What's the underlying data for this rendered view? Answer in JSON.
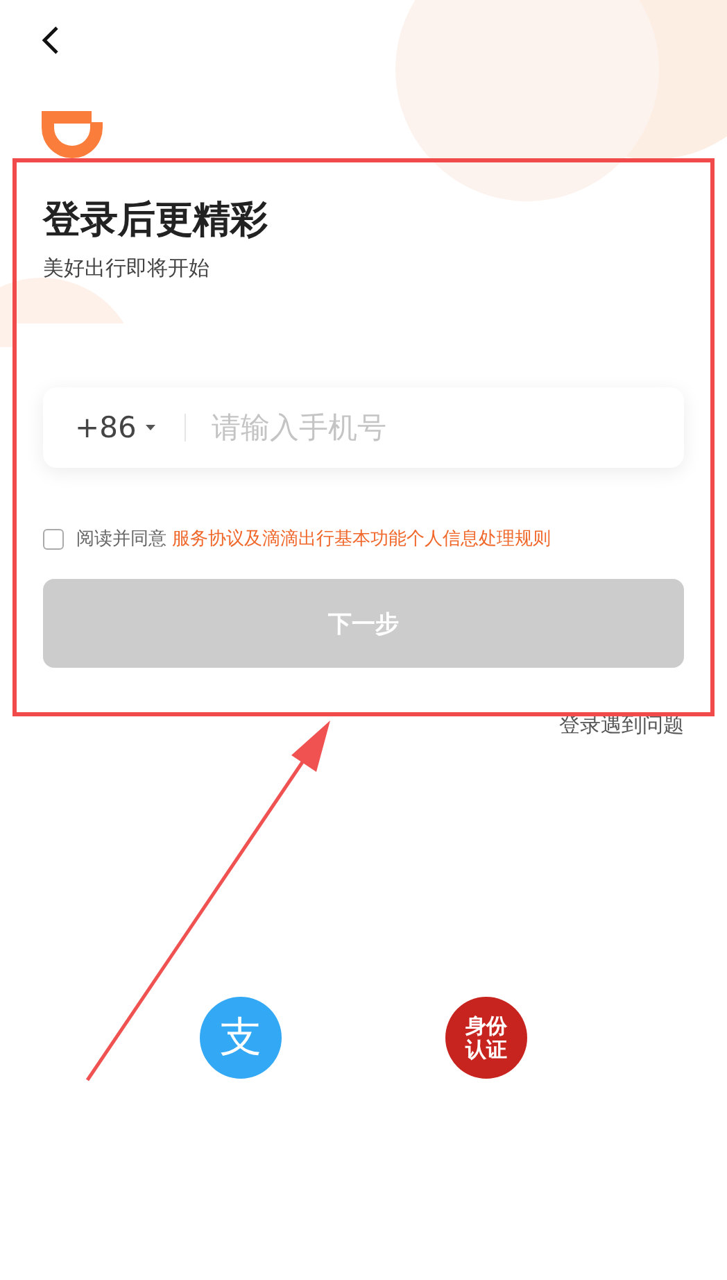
{
  "header": {
    "title": "登录后更精彩",
    "subtitle": "美好出行即将开始"
  },
  "phone": {
    "country_code": "+86",
    "placeholder": "请输入手机号"
  },
  "agreement": {
    "checked": false,
    "text": "阅读并同意",
    "link": "服务协议及滴滴出行基本功能个人信息处理规则"
  },
  "next_button": {
    "label": "下一步",
    "disabled": true
  },
  "help_link": "登录遇到问题",
  "login_options": [
    {
      "kind": "alipay",
      "glyph": "支"
    },
    {
      "kind": "id_card",
      "label": "身份认证"
    }
  ]
}
